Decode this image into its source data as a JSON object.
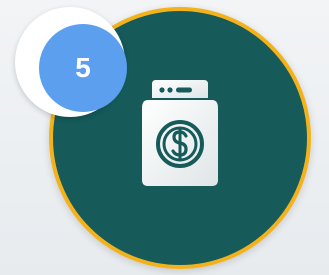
{
  "step_badge": {
    "number": "5",
    "color": "#5b9fee",
    "ring_color": "#ffffff"
  },
  "main_circle": {
    "fill_color": "#165a5a",
    "border_color": "#f4b21a",
    "icon": "money-bag-dollar-icon"
  }
}
